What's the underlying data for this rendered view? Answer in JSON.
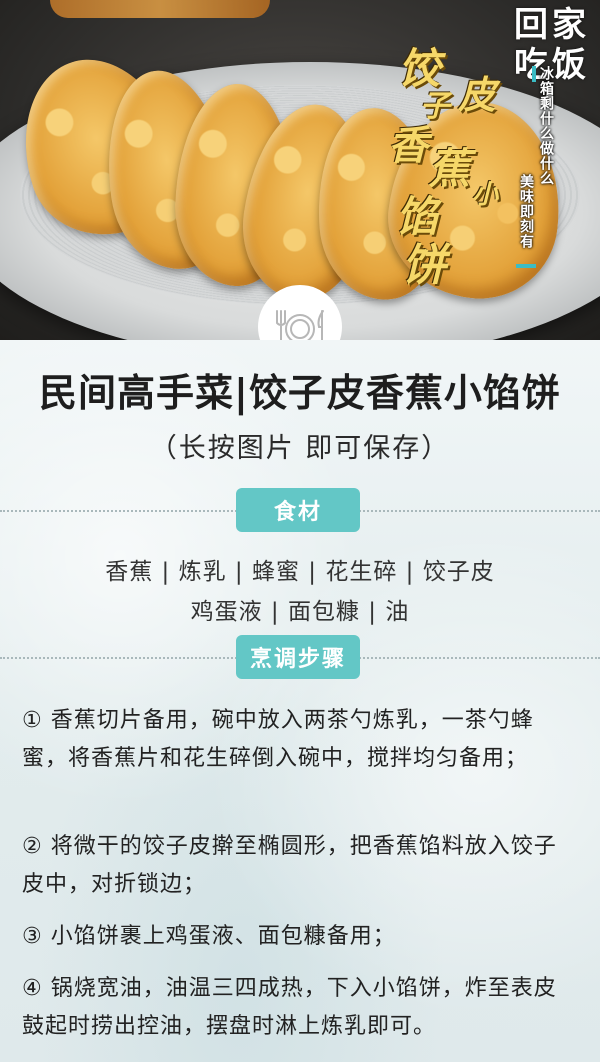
{
  "hero": {
    "logo": {
      "chars": [
        "回",
        "家",
        "吃",
        "饭"
      ]
    },
    "calligraphy_title": "饺子皮香蕉小馅饼",
    "banner_line1": "冰箱剩什么做什么",
    "banner_line2": "美味即刻有",
    "accent_color": "#3bbcc4"
  },
  "title": "民间高手菜|饺子皮香蕉小馅饼",
  "subtitle": "（长按图片  即可保存）",
  "ingredients": {
    "heading": "食材",
    "line1": "香蕉 | 炼乳 | 蜂蜜 | 花生碎 | 饺子皮",
    "line2": "鸡蛋液 | 面包糠 | 油"
  },
  "steps": {
    "heading": "烹调步骤",
    "items": [
      "① 香蕉切片备用，碗中放入两茶勺炼乳，一茶勺蜂蜜，将香蕉片和花生碎倒入碗中，搅拌均匀备用；",
      "② 将微干的饺子皮擀至椭圆形，把香蕉馅料放入饺子皮中，对折锁边；",
      "③ 小馅饼裹上鸡蛋液、面包糠备用；",
      "④ 锅烧宽油，油温三四成热，下入小馅饼，炸至表皮鼓起时捞出控油，摆盘时淋上炼乳即可。"
    ]
  },
  "colors": {
    "pill": "#63c7c6",
    "background": "#e6eff1"
  }
}
